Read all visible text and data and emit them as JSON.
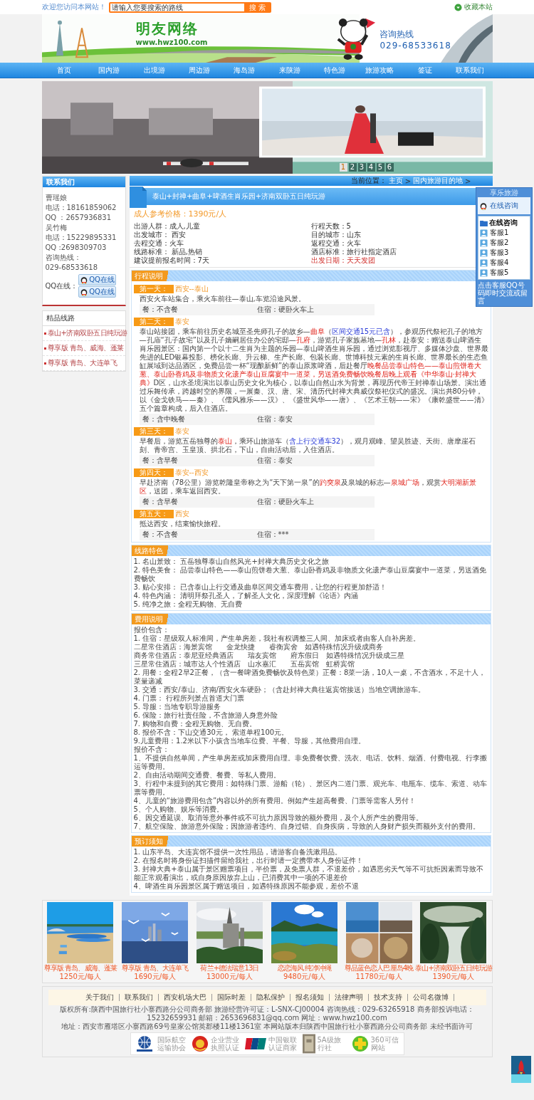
{
  "top_bar": {
    "welcome": "欢迎您访问本网站！",
    "search": {
      "placeholder": "请输入您要搜索的路线"
    },
    "search_button": "搜 索",
    "bookmark": "收藏本站"
  },
  "banner": {
    "site_name": "明友网络",
    "site_url": "www.hwz100.com",
    "hotline_label": "咨询热线",
    "hotline": "029-68533618"
  },
  "nav": [
    "首页",
    "国内游",
    "出境游",
    "周边游",
    "海岛游",
    "来陕游",
    "特色游",
    "旅游攻略",
    "签证",
    "联系我们"
  ],
  "slideshow": {
    "slides": [
      {
        "label": "1",
        "selected": true
      },
      {
        "label": "2",
        "selected": false
      },
      {
        "label": "3",
        "selected": false
      },
      {
        "label": "4",
        "selected": false
      },
      {
        "label": "5",
        "selected": false
      },
      {
        "label": "6",
        "selected": false
      }
    ]
  },
  "contact": {
    "title": "联系我们",
    "lines": [
      "曹瑶娘",
      "电话：18161859062",
      "QQ ：2657936831",
      "吴竹梅",
      "电话：15229895331",
      "QQ :2698309703",
      "咨询热线：",
      "029-68533618"
    ],
    "qq_label": "QQ在线：",
    "qq_buttons": [
      "QQ在线",
      "QQ在线"
    ]
  },
  "featured_routes": {
    "title": "精品线路",
    "items": [
      "泰山+济南双卧五日纯玩游",
      "尊享版 青岛、威海、蓬莱",
      "尊享版 青岛、大连单飞"
    ]
  },
  "breadcrumb": {
    "label": "当前位置：",
    "items": [
      "主页",
      "国内旅游目的地"
    ],
    "separator": ">"
  },
  "tour": {
    "title": "泰山+封禅+曲阜+啤酒生肖乐园+济南双卧五日纯玩游",
    "price": "成人参考价格：1390元/人",
    "info": [
      {
        "text": "出游人群：成人,儿童",
        "kind": "normal"
      },
      {
        "text": "行程天数：5",
        "kind": "normal"
      },
      {
        "text": "出发城市： 西安",
        "kind": "normal"
      },
      {
        "text": "目的城市：山东",
        "kind": "normal"
      },
      {
        "text": "去程交通：火车",
        "kind": "normal"
      },
      {
        "text": "返程交通：火车",
        "kind": "normal"
      },
      {
        "text": "线路标准： 新品,热销",
        "kind": "normal"
      },
      {
        "text": "酒店标准：旅行社指定酒店",
        "kind": "normal"
      },
      {
        "text": "建议提前报名时间：7天",
        "kind": "normal"
      },
      {
        "text": "出发日期：天天发团",
        "kind": "highlight"
      }
    ]
  },
  "sections": [
    {
      "title": "行程说明",
      "kind": "itinerary",
      "days": [
        {
          "day": "第一天：",
          "route": "西安--泰山",
          "text": [
            {
              "text": "西安火车站集合，乘火车前往—泰山,车览沿途风景。",
              "kind": "plain"
            }
          ],
          "meal": "餐：不含餐",
          "stay": "住宿：硬卧火车上"
        },
        {
          "day": "第二天：",
          "route": "泰安",
          "text": [
            {
              "text": "泰山站接团，乘车前往历史名城至圣先师孔子的故乡—",
              "kind": "plain"
            },
            {
              "text": "曲阜",
              "kind": "red"
            },
            {
              "text": "（",
              "kind": "plain"
            },
            {
              "text": "区间交通15元已含",
              "kind": "blue"
            },
            {
              "text": "），参观历代祭祀孔子的地方—孔庙“孔子故宅”以及孔子嫡嗣居住办公的宅邸—",
              "kind": "plain"
            },
            {
              "text": "孔府",
              "kind": "red"
            },
            {
              "text": "，游览孔子家族墓地—",
              "kind": "plain"
            },
            {
              "text": "孔林",
              "kind": "red"
            },
            {
              "text": "，赴泰安：赠送泰山啤酒生肖乐园景区：国内第一个以十二生肖为主题的乐园—泰山啤酒生肖乐园，通过浏览影视厅、多媒体沙盘、世界最先进的LED银幕投影、榜化长廊、升云梯、生产长廊、包装长廊、世博科技元素的生肖长廊、世界最长的生态鱼缸展域到达品酒区，免费品尝一杯“现酿新鲜”的泰山原浆啤酒，后赴餐厅",
              "kind": "plain"
            },
            {
              "text": "晚餐品尝泰山特色——泰山煎饼卷大葱、泰山卧香鸡及非物质文化遗产泰山豆腐宴中一道菜，另送酒免费畅饮晚餐后晚上观看《中华泰山·封禅大典》",
              "kind": "red"
            },
            {
              "text": "D区，山水圣境演出以泰山历史文化为核心，以泰山自然山水为背景，再现历代帝王封禅泰山场景。演出通过乐舞传承，跨越时空的界限，一展秦、汉、唐、宋、清历代封禅大典威仪祭祀仪式的盛况。演出共80分钟，以《金戈铁马——秦》、《儒风雅乐——汉》、《盛世风华——唐》、《艺术王朝——宋》《康乾盛世——清》五个篇章构成，后入住酒店。",
              "kind": "plain"
            }
          ],
          "meal": "餐：含中晚餐",
          "stay": "住宿：泰安"
        },
        {
          "day": "第三天：",
          "route": "泰安",
          "text": [
            {
              "text": "早餐后，游览五岳独尊的",
              "kind": "plain"
            },
            {
              "text": "泰山",
              "kind": "red"
            },
            {
              "text": "，乘环山旅游车（",
              "kind": "plain"
            },
            {
              "text": "含上行交通车32",
              "kind": "blue"
            },
            {
              "text": "），观月观峰、望吴胜迹、天街、唐摩崖石刻、青帝宫、玉皇顶、拱北石，下山，自由活动后，入住酒店。",
              "kind": "plain"
            }
          ],
          "meal": "餐：含早餐",
          "stay": "住宿：泰安"
        },
        {
          "day": "第四天：",
          "route": "泰安--西安",
          "text": [
            {
              "text": "早赴济南（78公里）游览乾隆皇帝称之为“天下第一泉”的",
              "kind": "plain"
            },
            {
              "text": "趵突泉",
              "kind": "red"
            },
            {
              "text": "及泉城的标志—",
              "kind": "plain"
            },
            {
              "text": "泉城广场",
              "kind": "red"
            },
            {
              "text": "，观赏",
              "kind": "plain"
            },
            {
              "text": "大明湖新景区",
              "kind": "red"
            },
            {
              "text": "，送团，乘车返回西安。",
              "kind": "plain"
            }
          ],
          "meal": "餐：含早餐",
          "stay": "住宿：硬卧火车上"
        },
        {
          "day": "第五天：",
          "route": "西安",
          "text": [
            {
              "text": "抵达西安，结束愉快旅程。",
              "kind": "plain"
            }
          ],
          "meal": "餐：不含餐",
          "stay": "住宿：***"
        }
      ]
    },
    {
      "title": "线路特色",
      "kind": "list",
      "lines": [
        "1. 名山景致： 五岳独尊泰山自然风光+封禅大典历史文化之旅",
        "2. 特色美食： 品尝泰山特色——泰山煎饼卷大葱、泰山卧香鸡及非物质文化遗产泰山豆腐宴中一道菜，另送酒免费畅饮",
        "3. 贴心安排： 已含泰山上行交通及曲阜区间交通车费用，让您的行程更加舒适！",
        "4. 特色内涵： 清明拜祭孔圣人，了解圣人文化，深度理解《论语》内涵",
        "5. 纯净之旅：全程无购物、无自费"
      ]
    },
    {
      "title": "费用说明",
      "kind": "list",
      "lines": [
        "报价包含：",
        "1. 住宿：星级双人标准间，产生单房差，我社有权调整三人间、加床或者由客人自补房差。",
        "二星常住酒店：海景宾馆　　金龙快捷　　睿衡宾舍　如遇特殊情况升级成商务",
        "商务常住酒店：泰尼亚经典酒店　　瑞友宾馆　　府东假日　如遇特殊情况升级成三星",
        "三星常住酒店：城市达人个性酒店　山水嘉汇　　五岳宾馆　虹桥宾馆",
        "2. 用餐：全程2早2正餐，（含一餐啤酒免费畅饮及特色菜）正餐：8菜一汤，10人一桌，不含酒水，不足十人，菜量递减",
        "3. 交通：西安/泰山、济南/西安火车硬卧；（含赴封禅大典往返宾馆接送）当地空调旅游车。",
        "4. 门票： 行程所列景点首道大门票",
        "5. 导服：当地专职导游服务",
        "6. 保险：旅行社责任险，不含旅游人身意外险",
        "7. 购物和自费：全程无购物、无自费。",
        "8. 报价不含：下山交通30元， 索道单程100元。",
        "9.儿童费用：1.2米以下小孩含当地车位费、半餐、导服，其他费用自理。",
        "报价不含：",
        "1、不提供自然单间，产生单房差或加床费用自理。非免费餐饮费、洗衣、电话、饮料、烟酒、付费电视、行李搬运等费用。",
        "2、自由活动期间交通费、餐费、等私人费用。",
        "3、行程中未提到的其它费用：如特殊门票、游船（轮）、景区内二道门票、观光车、电瓶车、缆车、索道、动车票等费用。",
        "4、儿童的“旅游费用包含”内容以外的所有费用。例如产生超高餐费、门票等需客人另付！",
        "5、个人购物、娱乐等消费。",
        "6、因交通延误、取消等意外事件或不可抗力原因导致的额外费用，及个人所产生的费用等。",
        "7、航空保险、旅游意外保险；因旅游者违约、自身过错、自身疾病，导致的人身财产损失而额外支付的费用。"
      ]
    },
    {
      "title": "预订须知",
      "kind": "list",
      "lines": [
        "1. 山东半岛、大连宾馆不提供一次性用品，请游客自备洗漱用品。",
        "2. 在报名时将身份证扫描件留给我社，出行时请一定携带本人身份证件！",
        "3. 封禅大典+泰山属于景区赠票项目，半价票，及免票人群，不退差价，如遇恶劣天气等不可抗拒因素而导致不能正常观看演出，或自身原因放弃上山，已消费其中一项的不退差价",
        "4、啤酒生肖乐园景区属于赠送项目，如遇特殊原因不能参观，差价不退"
      ]
    }
  ],
  "gallery": [
    {
      "name": "尊享版 青岛、威海、蓬莱",
      "price": "1250元/每人"
    },
    {
      "name": "尊享版 青岛、大连单飞",
      "price": "1690元/每人"
    },
    {
      "name": "荷兰+德法瑞意13日",
      "price": "13000元/每人"
    },
    {
      "name": "恋恋海风 纯净冲绳",
      "price": "9480元/每人"
    },
    {
      "name": "尊品蓝色恋人巴厘岛4晚",
      "price": "11780元/每人"
    },
    {
      "name": "泰山+济南双卧五日纯玩游",
      "price": "1390元/每人"
    }
  ],
  "qq_panel": {
    "title": "享乐旅游",
    "status": "在线咨询",
    "group": "在线咨询",
    "agents": [
      "客服1",
      "客服2",
      "客服3",
      "客服4",
      "客服5"
    ],
    "note": "点击客服QQ号码即时交流或留言"
  },
  "footer": {
    "links": [
      "关于我们",
      "联系我们",
      "西安机场大巴",
      "国际时差",
      "隐私保护",
      "报名须知",
      "法律声明",
      "技术支持",
      "公司名微博"
    ],
    "copyright": "版权所有:陕西中国旅行社小寨西路分公司商务部 旅游经营许可证：L-SNX-CJ00004 咨询热线：029-63265918 商务部投诉电话：15232659931 邮箱：2653696831@qq.com 网址：www.hwz100.com",
    "address": "地址：西安市雁塔区小寨西路69号皇家公馆英郡楼11楼1361室 本网站版本归陕西中国旅行社小寨西路分公司商务部 未经书面许可",
    "badges": [
      {
        "kind": "globe",
        "text": "国际航空运输协会"
      },
      {
        "kind": "emblem",
        "text": "企业营业执照认证"
      },
      {
        "kind": "card",
        "text": "中国银联认证商家"
      },
      {
        "kind": "plaque",
        "text": "5A级旅行社"
      },
      {
        "kind": "shield",
        "text": "360可信网站"
      }
    ]
  }
}
